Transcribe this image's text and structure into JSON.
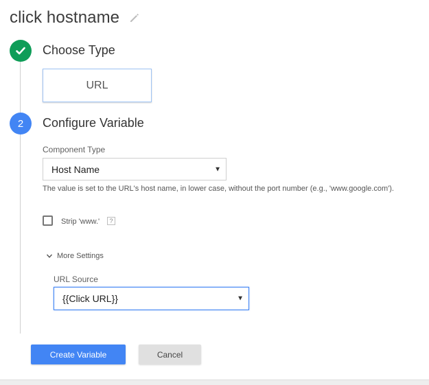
{
  "header": {
    "title": "click hostname",
    "edit_icon": "pencil-icon"
  },
  "steps": [
    {
      "number": "",
      "title": "Choose Type",
      "icon": "check-icon",
      "color": "#0f9d58"
    },
    {
      "number": "2",
      "title": "Configure Variable",
      "color": "#4285f4"
    }
  ],
  "choose_type": {
    "selected_type": "URL"
  },
  "configure": {
    "component_type_label": "Component Type",
    "component_type_value": "Host Name",
    "component_help": "The value is set to the URL's host name, in lower case, without the port number (e.g., 'www.google.com').",
    "strip_label": "Strip 'www.'",
    "strip_help": "?",
    "strip_checked": false,
    "more_settings_label": "More Settings",
    "url_source_label": "URL Source",
    "url_source_value": "{{Click URL}}"
  },
  "actions": {
    "create_label": "Create Variable",
    "cancel_label": "Cancel"
  },
  "colors": {
    "primary": "#4285f4",
    "success": "#0f9d58"
  }
}
